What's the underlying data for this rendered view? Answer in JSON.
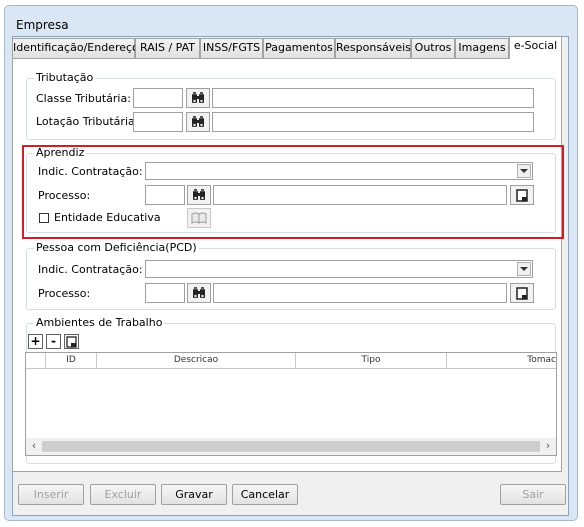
{
  "window": {
    "title": "Empresa"
  },
  "tabs": [
    {
      "label": "Identificação/Endereço"
    },
    {
      "label": "RAIS / PAT"
    },
    {
      "label": "INSS/FGTS"
    },
    {
      "label": "Pagamentos"
    },
    {
      "label": "Responsáveis"
    },
    {
      "label": "Outros"
    },
    {
      "label": "Imagens"
    },
    {
      "label": "e-Social"
    }
  ],
  "tributacao": {
    "legend": "Tributação",
    "classe_label": "Classe Tributária:",
    "lotacao_label": "Lotação Tributária"
  },
  "aprendiz": {
    "legend": "Aprendiz",
    "indic_label": "Indic. Contratação:",
    "processo_label": "Processo:",
    "entidade_label": "Entidade Educativa"
  },
  "pcd": {
    "legend": "Pessoa com Deficiência(PCD)",
    "indic_label": "Indic. Contratação:",
    "processo_label": "Processo:"
  },
  "ambientes": {
    "legend": "Ambientes de Trabalho",
    "add_label": "+",
    "remove_label": "-",
    "columns": [
      "ID",
      "Descricao",
      "Tipo",
      "Tomac"
    ]
  },
  "footer": {
    "inserir": "Inserir",
    "excluir": "Excluir",
    "gravar": "Gravar",
    "cancelar": "Cancelar",
    "sair": "Sair"
  },
  "icons": {
    "binoculars": "binoculars-icon",
    "document": "document-icon",
    "book": "book-icon"
  }
}
